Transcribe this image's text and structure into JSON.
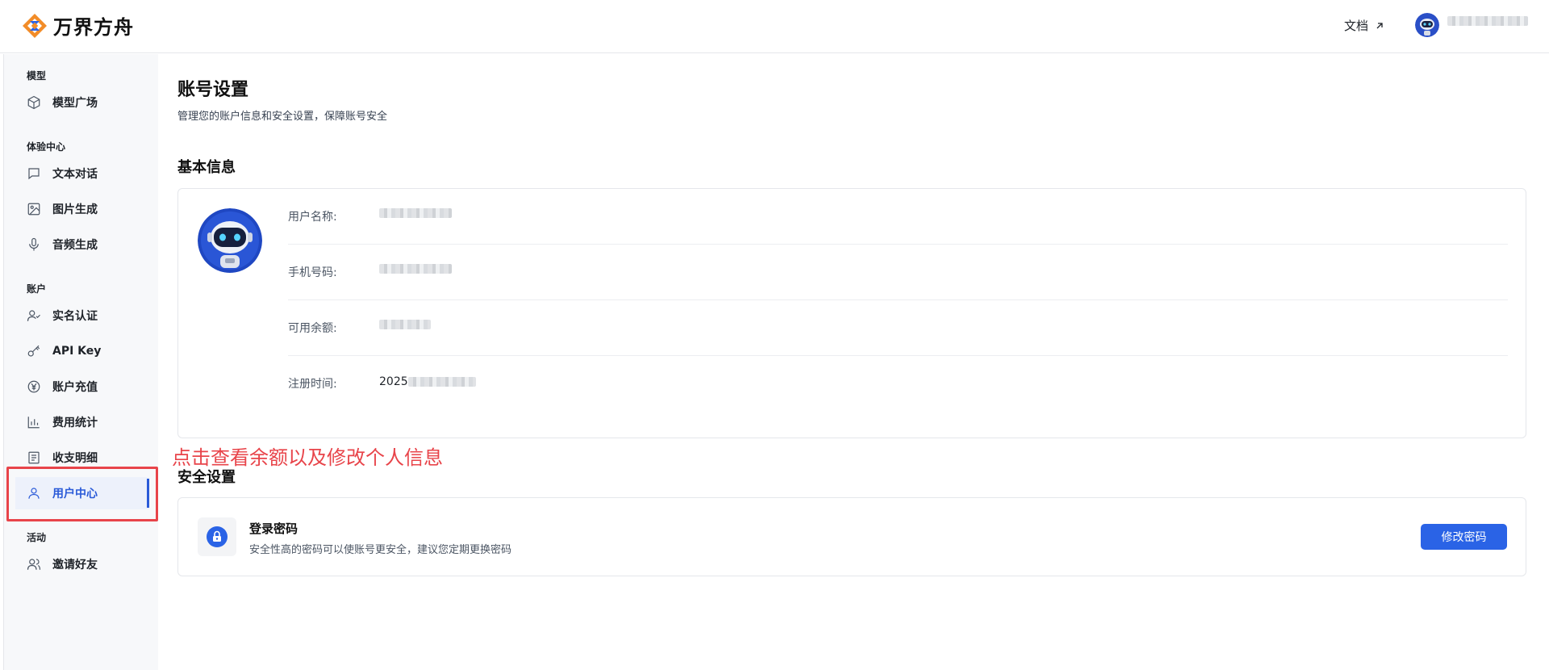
{
  "app": {
    "logo_text": "万界方舟",
    "docs_label": "文档"
  },
  "sidebar": {
    "sections": [
      {
        "label": "模型",
        "items": [
          {
            "label": "模型广场",
            "icon": "cube-icon"
          }
        ]
      },
      {
        "label": "体验中心",
        "items": [
          {
            "label": "文本对话",
            "icon": "chat-icon"
          },
          {
            "label": "图片生成",
            "icon": "image-icon"
          },
          {
            "label": "音频生成",
            "icon": "microphone-icon"
          }
        ]
      },
      {
        "label": "账户",
        "items": [
          {
            "label": "实名认证",
            "icon": "user-check-icon"
          },
          {
            "label": "API Key",
            "icon": "key-icon"
          },
          {
            "label": "账户充值",
            "icon": "yuan-icon"
          },
          {
            "label": "费用统计",
            "icon": "bar-chart-icon"
          },
          {
            "label": "收支明细",
            "icon": "document-icon"
          },
          {
            "label": "用户中心",
            "icon": "user-icon",
            "active": true
          }
        ]
      },
      {
        "label": "活动",
        "items": [
          {
            "label": "邀请好友",
            "icon": "users-icon"
          }
        ]
      }
    ]
  },
  "page": {
    "title": "账号设置",
    "description": "管理您的账户信息和安全设置，保障账号安全"
  },
  "basic_info": {
    "title": "基本信息",
    "fields": [
      {
        "label": "用户名称:",
        "value": ""
      },
      {
        "label": "手机号码:",
        "value": ""
      },
      {
        "label": "可用余额:",
        "value": ""
      },
      {
        "label": "注册时间:",
        "value": "2025"
      }
    ]
  },
  "annotation": "点击查看余额以及修改个人信息",
  "security": {
    "title": "安全设置",
    "password_title": "登录密码",
    "password_desc": "安全性高的密码可以使账号更安全，建议您定期更换密码",
    "change_button": "修改密码"
  },
  "colors": {
    "accent": "#2a63e6",
    "annotation_red": "#e8444a",
    "sidebar_bg": "#f7f8fa"
  }
}
